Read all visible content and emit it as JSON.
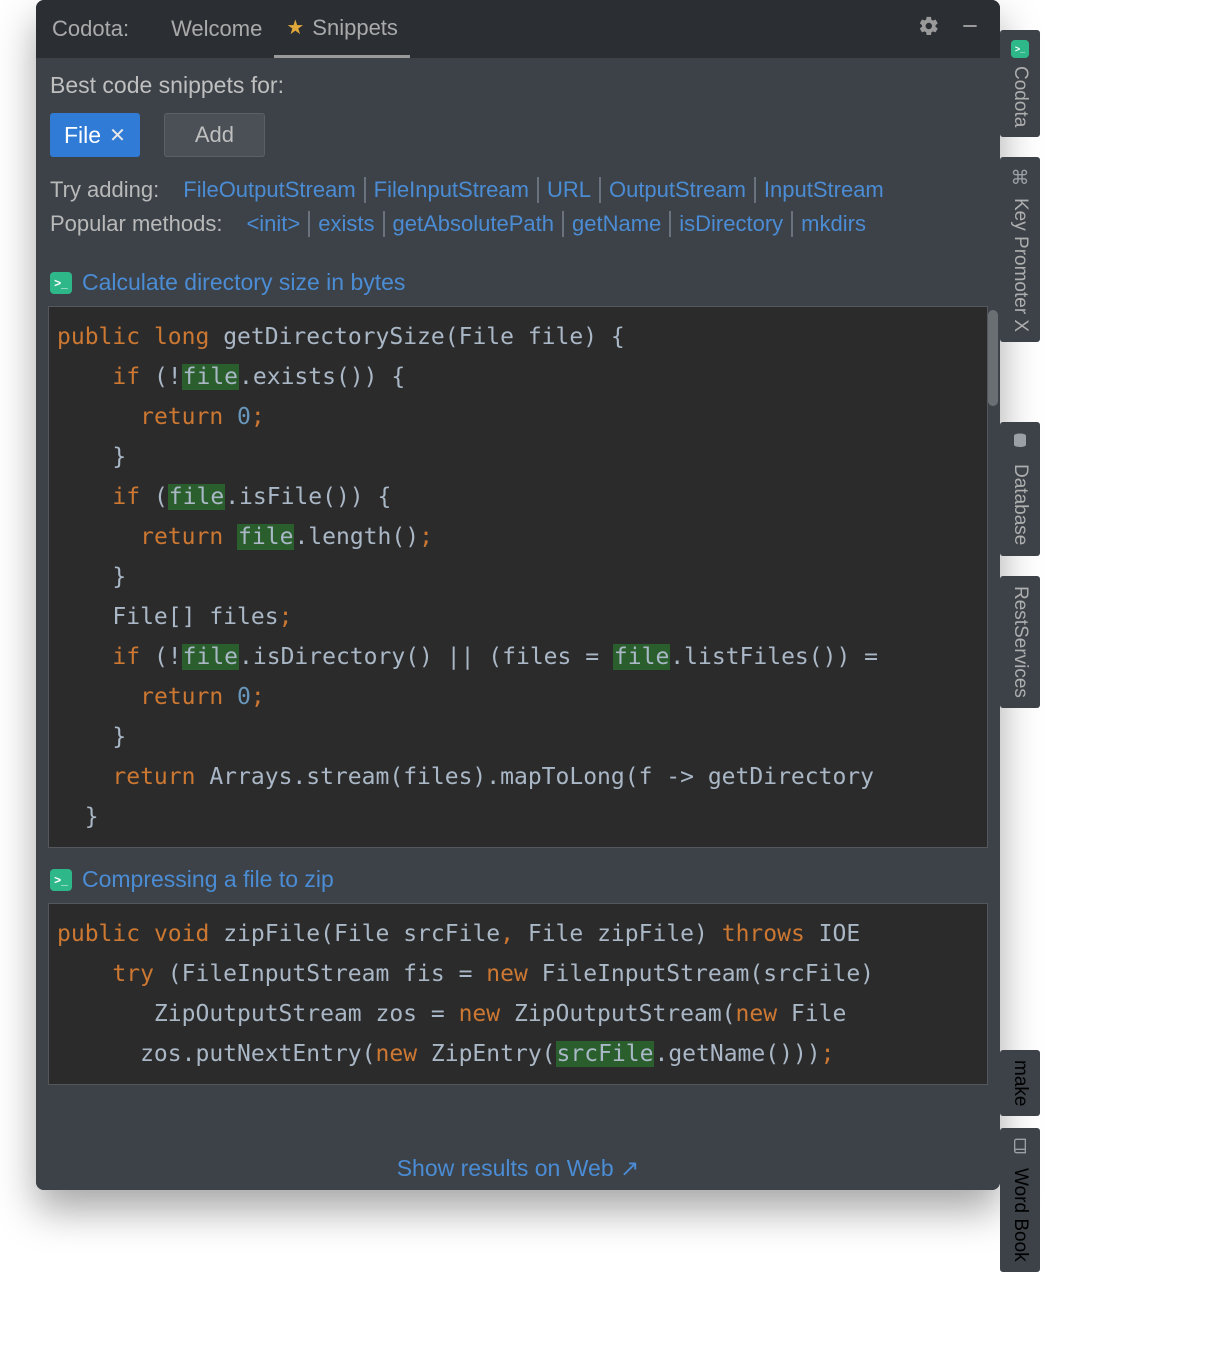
{
  "topbar": {
    "brand": "Codota:",
    "tabs": [
      {
        "label": "Welcome",
        "starred": false,
        "active": false
      },
      {
        "label": "Snippets",
        "starred": true,
        "active": true
      }
    ]
  },
  "header": {
    "best_for_label": "Best code snippets for:",
    "chip_label": "File",
    "add_label": "Add",
    "try_adding_label": "Try adding:",
    "try_adding_links": [
      "FileOutputStream",
      "FileInputStream",
      "URL",
      "OutputStream",
      "InputStream"
    ],
    "popular_label": "Popular methods:",
    "popular_links": [
      "<init>",
      "exists",
      "getAbsolutePath",
      "getName",
      "isDirectory",
      "mkdirs"
    ]
  },
  "snippets": [
    {
      "title": "Calculate directory size in bytes",
      "code_lines": [
        {
          "t": [
            {
              "c": "kw",
              "s": "public"
            },
            {
              "c": "",
              "s": " "
            },
            {
              "c": "kw",
              "s": "long"
            },
            {
              "c": "",
              "s": " getDirectorySize(File file) {"
            }
          ]
        },
        {
          "t": [
            {
              "c": "",
              "s": "    "
            },
            {
              "c": "kw",
              "s": "if"
            },
            {
              "c": "",
              "s": " (!"
            },
            {
              "c": "hl",
              "s": "file"
            },
            {
              "c": "",
              "s": ".exists()) {"
            }
          ]
        },
        {
          "t": [
            {
              "c": "",
              "s": "      "
            },
            {
              "c": "kw",
              "s": "return"
            },
            {
              "c": "",
              "s": " "
            },
            {
              "c": "num",
              "s": "0"
            },
            {
              "c": "punc",
              "s": ";"
            }
          ]
        },
        {
          "t": [
            {
              "c": "",
              "s": "    }"
            }
          ]
        },
        {
          "t": [
            {
              "c": "",
              "s": "    "
            },
            {
              "c": "kw",
              "s": "if"
            },
            {
              "c": "",
              "s": " ("
            },
            {
              "c": "hl",
              "s": "file"
            },
            {
              "c": "",
              "s": ".isFile()) {"
            }
          ]
        },
        {
          "t": [
            {
              "c": "",
              "s": "      "
            },
            {
              "c": "kw",
              "s": "return"
            },
            {
              "c": "",
              "s": " "
            },
            {
              "c": "hl",
              "s": "file"
            },
            {
              "c": "",
              "s": ".length()"
            },
            {
              "c": "punc",
              "s": ";"
            }
          ]
        },
        {
          "t": [
            {
              "c": "",
              "s": "    }"
            }
          ]
        },
        {
          "t": [
            {
              "c": "",
              "s": "    File[] files"
            },
            {
              "c": "punc",
              "s": ";"
            }
          ]
        },
        {
          "t": [
            {
              "c": "",
              "s": "    "
            },
            {
              "c": "kw",
              "s": "if"
            },
            {
              "c": "",
              "s": " (!"
            },
            {
              "c": "hl",
              "s": "file"
            },
            {
              "c": "",
              "s": ".isDirectory() || (files = "
            },
            {
              "c": "hl",
              "s": "file"
            },
            {
              "c": "",
              "s": ".listFiles()) ="
            }
          ]
        },
        {
          "t": [
            {
              "c": "",
              "s": "      "
            },
            {
              "c": "kw",
              "s": "return"
            },
            {
              "c": "",
              "s": " "
            },
            {
              "c": "num",
              "s": "0"
            },
            {
              "c": "punc",
              "s": ";"
            }
          ]
        },
        {
          "t": [
            {
              "c": "",
              "s": "    }"
            }
          ]
        },
        {
          "t": [
            {
              "c": "",
              "s": "    "
            },
            {
              "c": "kw",
              "s": "return"
            },
            {
              "c": "",
              "s": " Arrays.stream(files).mapToLong(f -> getDirectory"
            }
          ]
        },
        {
          "t": [
            {
              "c": "",
              "s": "  }"
            }
          ]
        }
      ]
    },
    {
      "title": "Compressing a file to zip",
      "code_lines": [
        {
          "t": [
            {
              "c": "kw",
              "s": "public"
            },
            {
              "c": "",
              "s": " "
            },
            {
              "c": "kw",
              "s": "void"
            },
            {
              "c": "",
              "s": " zipFile(File srcFile"
            },
            {
              "c": "punc",
              "s": ","
            },
            {
              "c": "",
              "s": " File zipFile) "
            },
            {
              "c": "kw",
              "s": "throws"
            },
            {
              "c": "",
              "s": " IOE"
            }
          ]
        },
        {
          "t": [
            {
              "c": "",
              "s": "    "
            },
            {
              "c": "kw",
              "s": "try"
            },
            {
              "c": "",
              "s": " (FileInputStream fis = "
            },
            {
              "c": "kw",
              "s": "new"
            },
            {
              "c": "",
              "s": " FileInputStream(srcFile)"
            }
          ]
        },
        {
          "t": [
            {
              "c": "",
              "s": "       ZipOutputStream zos = "
            },
            {
              "c": "kw",
              "s": "new"
            },
            {
              "c": "",
              "s": " ZipOutputStream("
            },
            {
              "c": "kw",
              "s": "new"
            },
            {
              "c": "",
              "s": " File"
            }
          ]
        },
        {
          "t": [
            {
              "c": "",
              "s": "      zos.putNextEntry("
            },
            {
              "c": "kw",
              "s": "new"
            },
            {
              "c": "",
              "s": " ZipEntry("
            },
            {
              "c": "hl",
              "s": "srcFile"
            },
            {
              "c": "",
              "s": ".getName()))"
            },
            {
              "c": "punc",
              "s": ";"
            }
          ]
        }
      ]
    }
  ],
  "footer": {
    "show_web": "Show results on Web ↗"
  },
  "right_rail": [
    {
      "label": "Codota",
      "icon": "codota"
    },
    {
      "label": "Key Promoter X",
      "icon": "key"
    },
    {
      "label": "Database",
      "icon": "db"
    },
    {
      "label": "RestServices",
      "icon": ""
    }
  ],
  "bottom_rail": [
    {
      "label": "make",
      "icon": ""
    },
    {
      "label": "Word Book",
      "icon": "book"
    }
  ]
}
